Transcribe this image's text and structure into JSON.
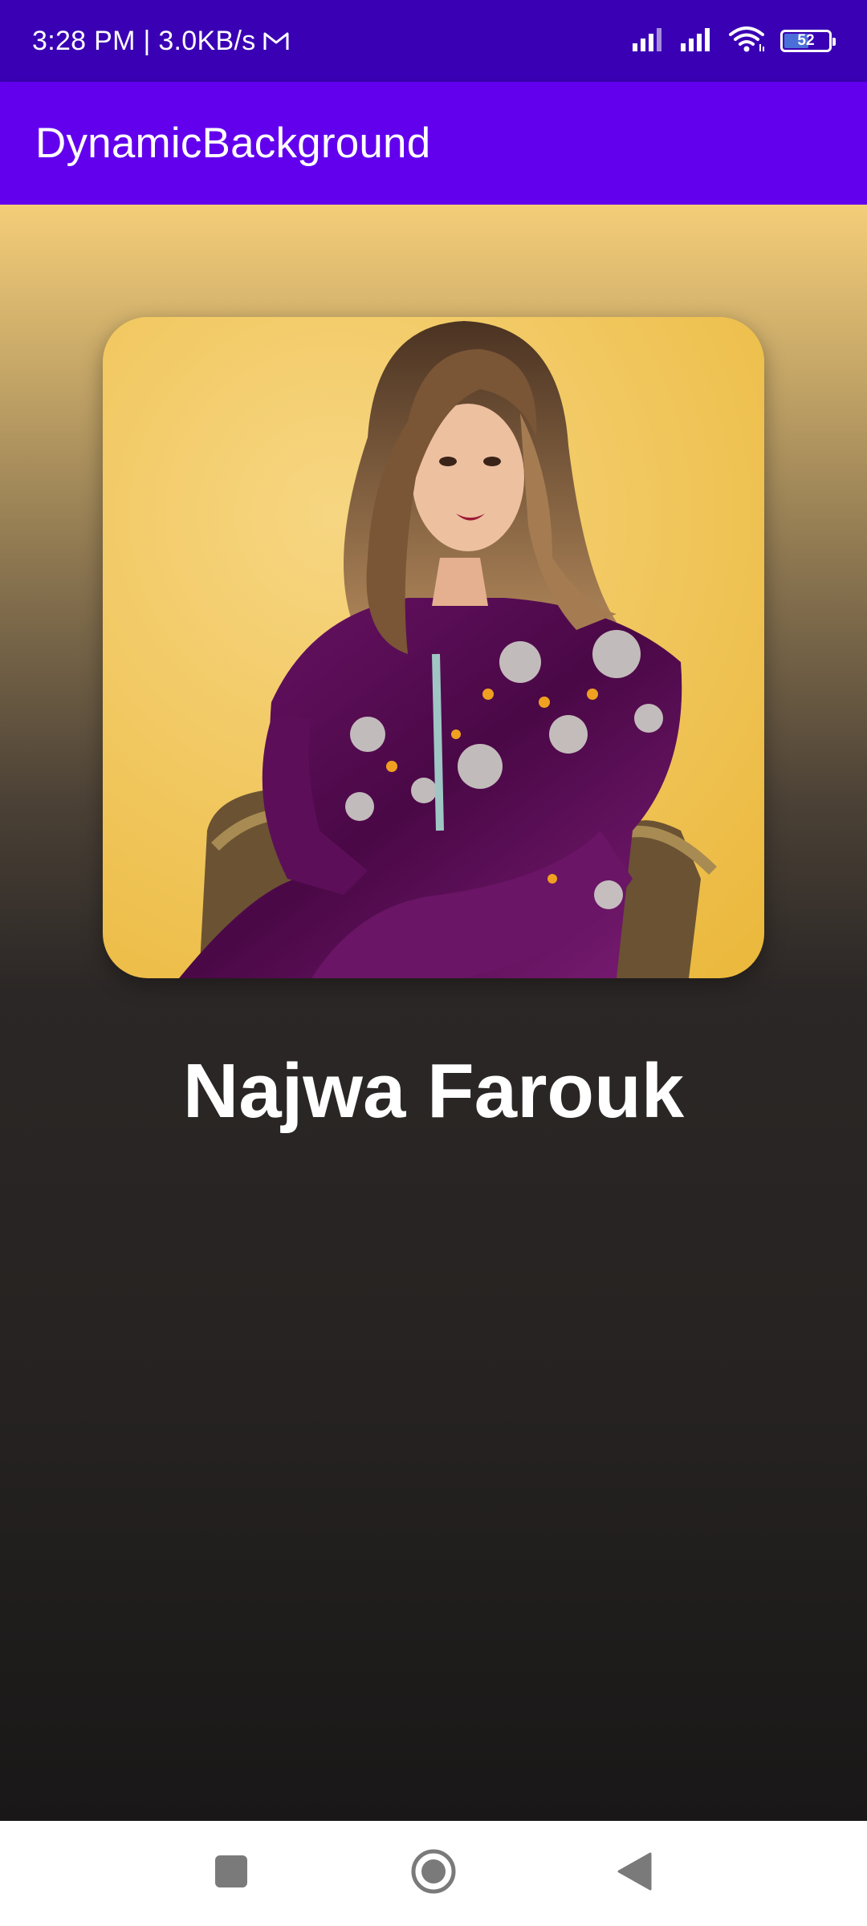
{
  "status_bar": {
    "time_speed": "3:28 PM | 3.0KB/s",
    "battery_level": "52",
    "icons": [
      "gmail-icon",
      "signal-icon",
      "signal-icon",
      "wifi-icon",
      "battery-icon"
    ]
  },
  "app_bar": {
    "title": "DynamicBackground"
  },
  "profile": {
    "name": "Najwa Farouk"
  },
  "nav_bar": {
    "icons": [
      "recents-square-icon",
      "home-circle-icon",
      "back-triangle-icon"
    ]
  },
  "colors": {
    "status_bar": "#3a01b4",
    "app_bar": "#6200ee",
    "gradient_top": "#f4cd78",
    "gradient_bottom": "#191717",
    "photo_background": "#f0c457",
    "dress": "#4f0a4d"
  }
}
